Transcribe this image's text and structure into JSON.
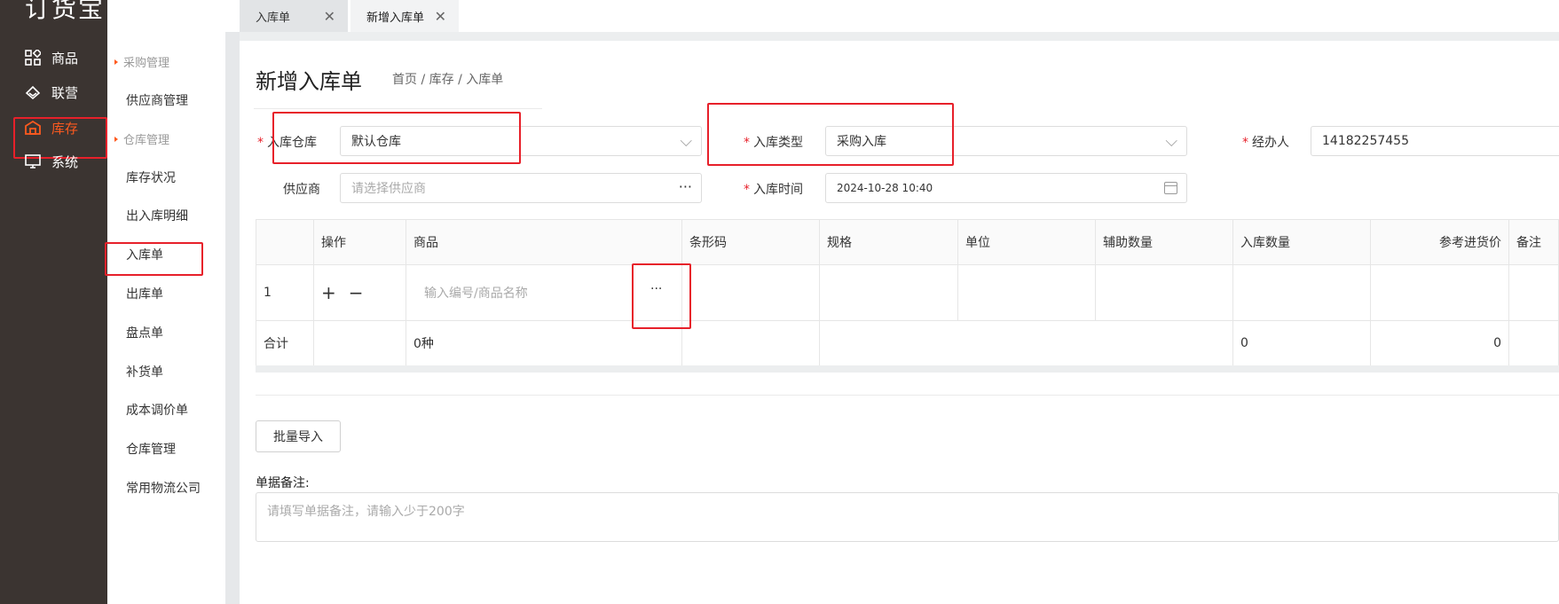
{
  "app": {
    "logo_text": "订货宝"
  },
  "sidebar": {
    "items": [
      {
        "label": "商品",
        "icon": "grid-icon"
      },
      {
        "label": "联营",
        "icon": "handshake-icon"
      },
      {
        "label": "库存",
        "icon": "warehouse-icon",
        "active": true
      },
      {
        "label": "系统",
        "icon": "monitor-icon"
      }
    ]
  },
  "submenu": {
    "group1": "采购管理",
    "supplier": "供应商管理",
    "group2": "仓库管理",
    "stock_status": "库存状况",
    "io_detail": "出入库明细",
    "inbound": "入库单",
    "outbound": "出库单",
    "stocktake": "盘点单",
    "replenish": "补货单",
    "cost_adjust": "成本调价单",
    "warehouse_mgmt": "仓库管理",
    "logistics": "常用物流公司"
  },
  "tabs": [
    {
      "label": "入库单"
    },
    {
      "label": "新增入库单"
    }
  ],
  "page": {
    "title": "新增入库单",
    "breadcrumb": "首页 / 库存 / 入库单"
  },
  "form": {
    "warehouse_label": "入库仓库",
    "warehouse_value": "默认仓库",
    "type_label": "入库类型",
    "type_value": "采购入库",
    "handler_label": "经办人",
    "handler_value": "14182257455",
    "supplier_label": "供应商",
    "supplier_placeholder": "请选择供应商",
    "time_label": "入库时间",
    "time_value": "2024-10-28 10:40"
  },
  "table": {
    "headers": [
      "",
      "操作",
      "商品",
      "条形码",
      "规格",
      "单位",
      "辅助数量",
      "入库数量",
      "参考进货价",
      "备注"
    ],
    "row": {
      "index": "1",
      "op_add": "+",
      "op_remove": "−",
      "product_placeholder": "输入编号/商品名称"
    },
    "summary": {
      "label": "合计",
      "kinds": "0种",
      "qty": "0",
      "price": "0"
    }
  },
  "actions": {
    "batch_import": "批量导入"
  },
  "remark": {
    "label": "单据备注:",
    "placeholder": "请填写单据备注，请输入少于200字"
  },
  "colors": {
    "accent": "#ff5a1f",
    "highlight": "#e7202a",
    "sidebar_bg": "#3b3431"
  }
}
